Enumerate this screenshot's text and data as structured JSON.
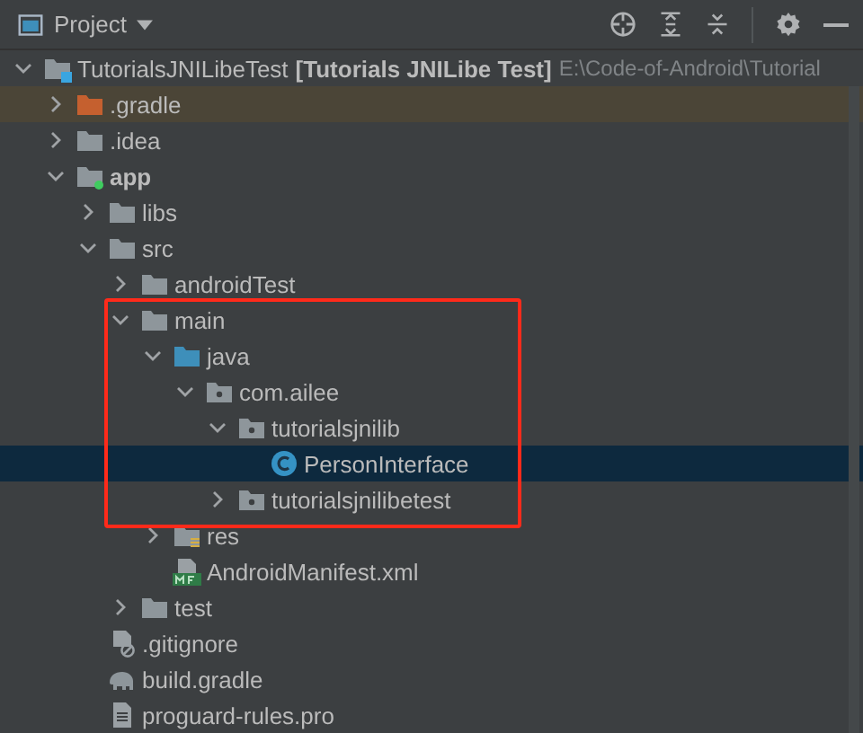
{
  "panel": {
    "title": "Project"
  },
  "tree": [
    {
      "name": "TutorialsJNILibeTest",
      "module_label": "[Tutorials JNILibe Test]",
      "path": "E:\\Code-of-Android\\Tutorial",
      "kind": "project",
      "expanded": true,
      "selected": false,
      "boxed": false,
      "children": [
        {
          "name": ".gradle",
          "kind": "excluded",
          "expanded": false,
          "selected": false,
          "boxed": false
        },
        {
          "name": ".idea",
          "kind": "folder",
          "expanded": false,
          "selected": false,
          "boxed": false
        },
        {
          "name": "app",
          "kind": "module",
          "expanded": true,
          "selected": false,
          "boxed": false,
          "children": [
            {
              "name": "libs",
              "kind": "folder",
              "expanded": false,
              "selected": false,
              "boxed": false
            },
            {
              "name": "src",
              "kind": "folder",
              "expanded": true,
              "selected": false,
              "boxed": false,
              "children": [
                {
                  "name": "androidTest",
                  "kind": "folder",
                  "expanded": false,
                  "selected": false,
                  "boxed": false
                },
                {
                  "name": "main",
                  "kind": "folder",
                  "expanded": true,
                  "selected": false,
                  "boxed": true,
                  "children": [
                    {
                      "name": "java",
                      "kind": "source",
                      "expanded": true,
                      "selected": false,
                      "boxed": true,
                      "children": [
                        {
                          "name": "com.ailee",
                          "kind": "package",
                          "expanded": true,
                          "selected": false,
                          "boxed": true,
                          "children": [
                            {
                              "name": "tutorialsjnilib",
                              "kind": "package",
                              "expanded": true,
                              "selected": false,
                              "boxed": true,
                              "children": [
                                {
                                  "name": "PersonInterface",
                                  "kind": "class",
                                  "selected": true,
                                  "boxed": true
                                }
                              ]
                            },
                            {
                              "name": "tutorialsjnilibetest",
                              "kind": "package",
                              "expanded": false,
                              "selected": false,
                              "boxed": true
                            }
                          ]
                        }
                      ]
                    },
                    {
                      "name": "res",
                      "kind": "resources",
                      "expanded": false,
                      "selected": false,
                      "boxed": false
                    },
                    {
                      "name": "AndroidManifest.xml",
                      "kind": "manifest",
                      "selected": false,
                      "boxed": false
                    }
                  ]
                },
                {
                  "name": "test",
                  "kind": "folder",
                  "expanded": false,
                  "selected": false,
                  "boxed": false
                }
              ]
            },
            {
              "name": ".gitignore",
              "kind": "ignore",
              "selected": false,
              "boxed": false
            },
            {
              "name": "build.gradle",
              "kind": "gradle",
              "selected": false,
              "boxed": false
            },
            {
              "name": "proguard-rules.pro",
              "kind": "file",
              "selected": false,
              "boxed": false
            }
          ]
        }
      ]
    }
  ]
}
